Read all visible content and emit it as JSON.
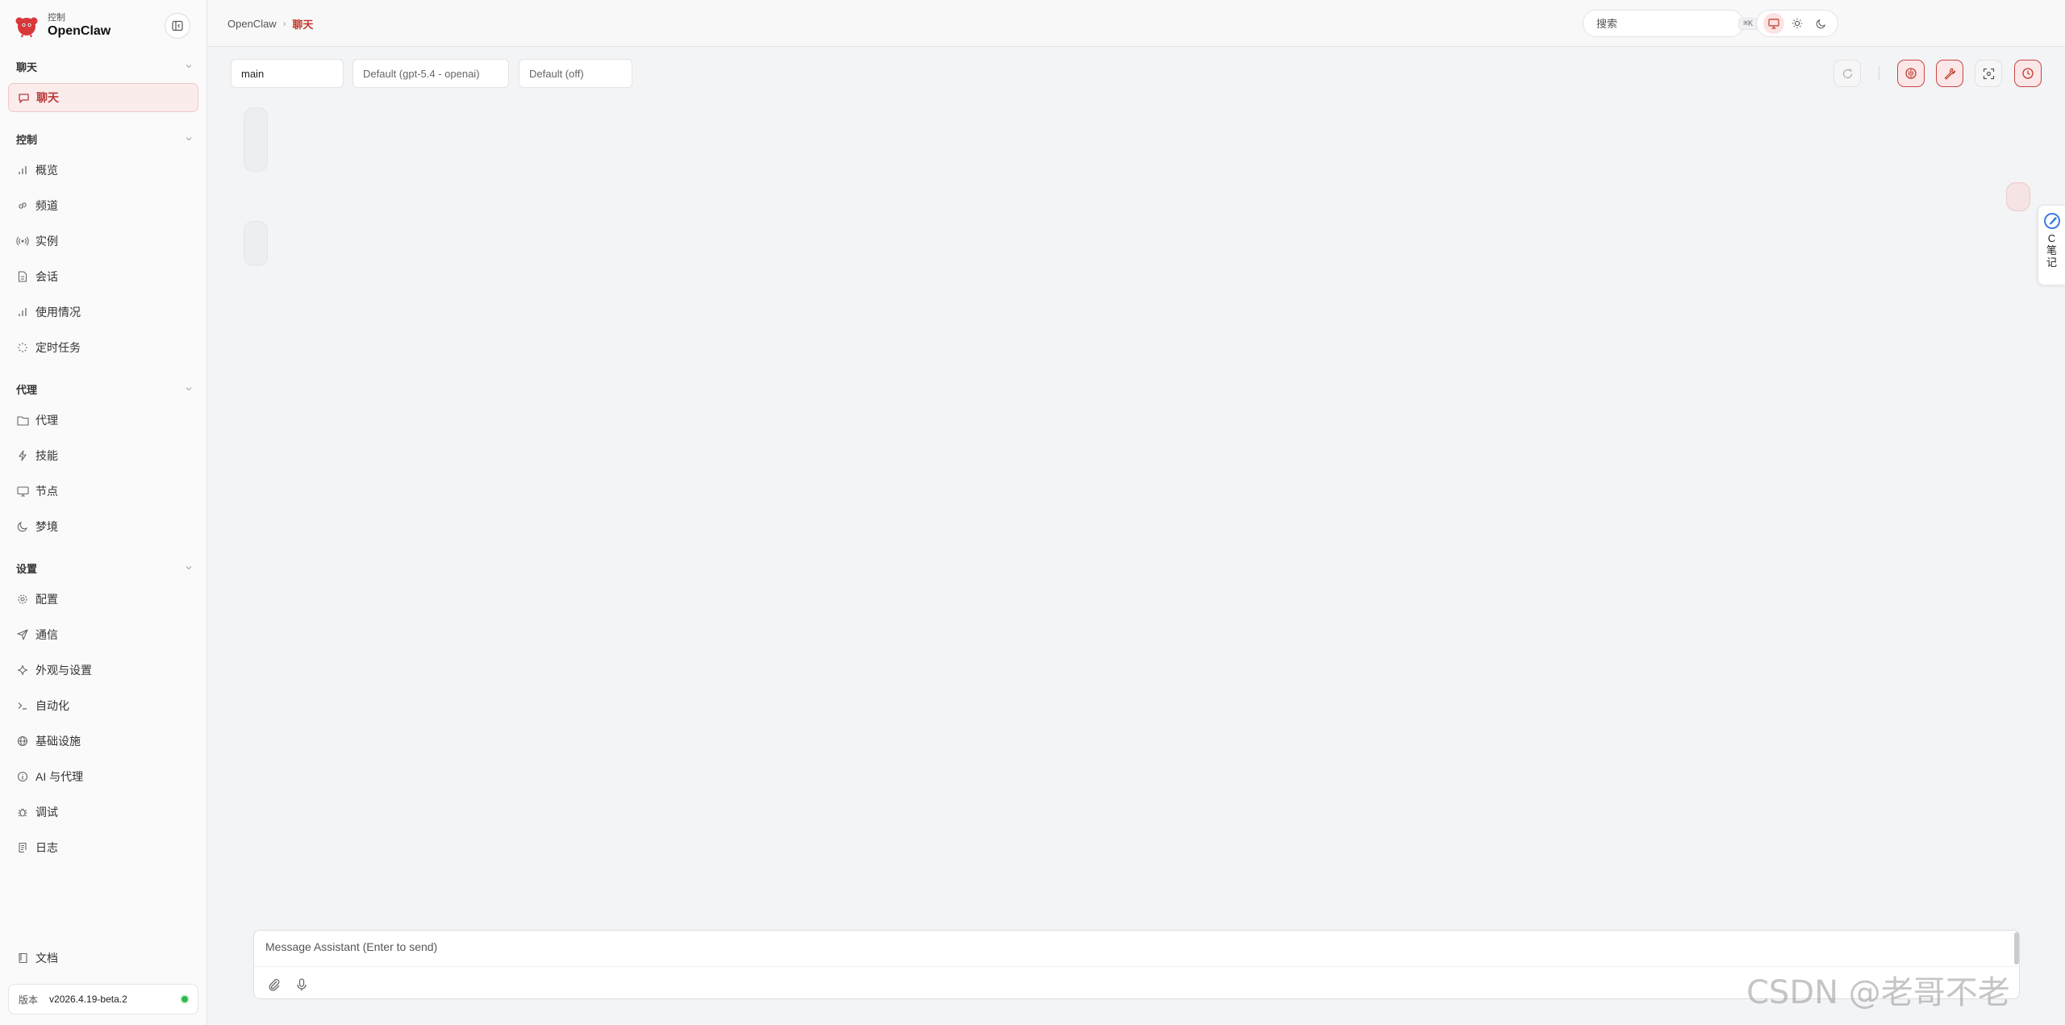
{
  "brand": {
    "subtitle": "控制",
    "name": "OpenClaw"
  },
  "sidebar": {
    "sections": {
      "chat": {
        "title": "聊天"
      },
      "control": {
        "title": "控制"
      },
      "agent": {
        "title": "代理"
      },
      "settings": {
        "title": "设置"
      }
    },
    "items": {
      "chat": "聊天",
      "overview": "概览",
      "channels": "频道",
      "instances": "实例",
      "sessions": "会话",
      "usage": "使用情况",
      "cron": "定时任务",
      "agents": "代理",
      "skills": "技能",
      "nodes": "节点",
      "dreams": "梦境",
      "config": "配置",
      "comms": "通信",
      "appearance": "外观与设置",
      "automation": "自动化",
      "infra": "基础设施",
      "ai_agents": "AI 与代理",
      "debug": "调试",
      "logs": "日志"
    },
    "docs": "文档",
    "version_label": "版本",
    "version_value": "v2026.4.19-beta.2"
  },
  "topbar": {
    "breadcrumb_root": "OpenClaw",
    "breadcrumb_sep": "›",
    "breadcrumb_current": "聊天",
    "search_placeholder": "搜索",
    "search_shortcut": "⌘K"
  },
  "chat": {
    "session": "main",
    "model": "Default (gpt-5.4 - openai)",
    "thinking": "Default (off)",
    "composer_placeholder": "Message Assistant (Enter to send)"
  },
  "note_tab": {
    "text": "C笔记"
  },
  "watermark": "CSDN @老哥不老",
  "colors": {
    "accent": "#c0392b",
    "active_bg": "#fbecec",
    "status_ok": "#2fb84e"
  }
}
